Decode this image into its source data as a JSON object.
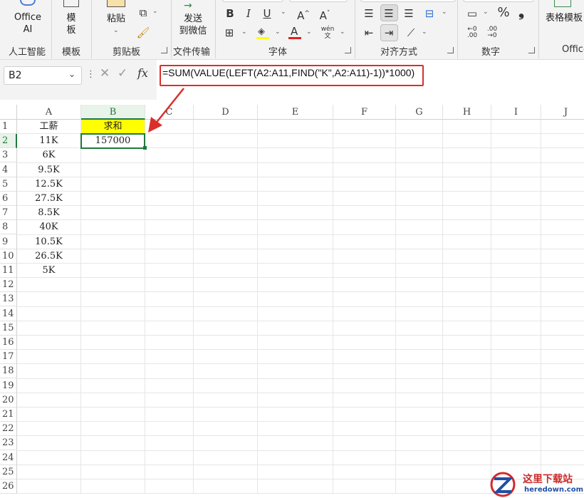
{
  "ribbon": {
    "groups": {
      "ai": "人工智能",
      "template": "模板",
      "clipboard": "剪贴板",
      "file_transfer": "文件传输",
      "font": "字体",
      "alignment": "对齐方式",
      "number": "数字",
      "office": "Office"
    },
    "office_ai": {
      "line1": "Office",
      "line2": "AI"
    },
    "template_btn": {
      "line1": "模",
      "line2": "板"
    },
    "paste_btn": "粘贴",
    "send_btn": {
      "line1": "发送",
      "line2": "到微信"
    },
    "table_template_btn": "表格模板",
    "font_buttons": {
      "bold": "B",
      "italic": "I",
      "underline": "U",
      "grow": "A^",
      "shrink": "A˅",
      "font_color": "A",
      "pinyin": "wén 文"
    },
    "number_buttons": {
      "percent": "%",
      "comma": "❟",
      "inc_decimal": ".00",
      "dec_decimal": ".00"
    }
  },
  "formula_bar": {
    "name_box": "B2",
    "fx_label": "fx",
    "formula": "=SUM(VALUE(LEFT(A2:A11,FIND(\"K\",A2:A11)-1))*1000)"
  },
  "sheet": {
    "columns": [
      "A",
      "B",
      "C",
      "D",
      "E",
      "F",
      "G",
      "H",
      "I",
      "J"
    ],
    "rows": [
      "1",
      "2",
      "3",
      "4",
      "5",
      "6",
      "7",
      "8",
      "9",
      "10",
      "11",
      "12",
      "13",
      "14",
      "15",
      "16",
      "17",
      "18",
      "19",
      "20",
      "21",
      "22",
      "23",
      "24",
      "25",
      "26"
    ],
    "cells": {
      "A1": "工薪",
      "B1": "求和",
      "A2": "11K",
      "B2": "157000",
      "A3": "6K",
      "A4": "9.5K",
      "A5": "12.5K",
      "A6": "27.5K",
      "A7": "8.5K",
      "A8": "40K",
      "A9": "10.5K",
      "A10": "26.5K",
      "A11": "5K"
    },
    "selected_cell": "B2",
    "highlight_color": "#ffff00"
  },
  "watermark": {
    "title": "这里下载站",
    "url": "heredown.com"
  },
  "colors": {
    "accent_green": "#1e7a3a",
    "annotation_red": "#d9302b"
  }
}
